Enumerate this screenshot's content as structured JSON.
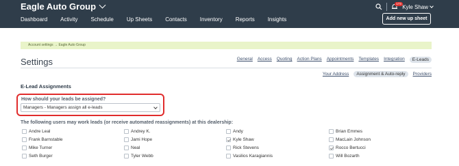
{
  "header": {
    "brand": "Eagle Auto Group",
    "nav": [
      "Dashboard",
      "Activity",
      "Schedule",
      "Up Sheets",
      "Contacts",
      "Inventory",
      "Reports",
      "Insights"
    ],
    "notification_count": "173",
    "user_name": "Kyle Shaw",
    "add_button": "Add new up sheet"
  },
  "breadcrumb": "Account settings → Eagle Auto Group",
  "page_title": "Settings",
  "tabs": [
    "General",
    "Access",
    "Quoting",
    "Action Plans",
    "Appointments",
    "Templates",
    "Integration",
    "E-Leads"
  ],
  "active_tab": "E-Leads",
  "subtabs": [
    "Your Address",
    "Assignment & Auto-reply",
    "Providers"
  ],
  "active_subtab": "Assignment & Auto-reply",
  "section_title": "E-Lead Assignments",
  "assignment": {
    "question": "How should your leads be assigned?",
    "selected": "Managers - Managers assign all e-leads"
  },
  "users_label": "The following users may work leads (or receive automated reassignments) at this dealership:",
  "users": [
    {
      "name": "Andre Leal",
      "checked": false
    },
    {
      "name": "Andrey K.",
      "checked": false
    },
    {
      "name": "Andy",
      "checked": false
    },
    {
      "name": "Brian Emmes",
      "checked": false
    },
    {
      "name": "Frank Barnstable",
      "checked": false
    },
    {
      "name": "Jami Hope",
      "checked": false
    },
    {
      "name": "Kyle Shaw",
      "checked": true
    },
    {
      "name": "MacLain Johnson",
      "checked": false
    },
    {
      "name": "Mike Turner",
      "checked": false
    },
    {
      "name": "Neal",
      "checked": false
    },
    {
      "name": "Rick Stevens",
      "checked": false
    },
    {
      "name": "Rocco Bertucci",
      "checked": true
    },
    {
      "name": "Seth Burger",
      "checked": false
    },
    {
      "name": "Tyler Webb",
      "checked": false
    },
    {
      "name": "Vasilios Karagiannis",
      "checked": false
    },
    {
      "name": "Will Bozarth",
      "checked": false
    }
  ],
  "colors": {
    "topbar": "#2f3d4a",
    "highlight": "#e02b2b",
    "breadcrumb_bg": "#e9f4c9"
  }
}
